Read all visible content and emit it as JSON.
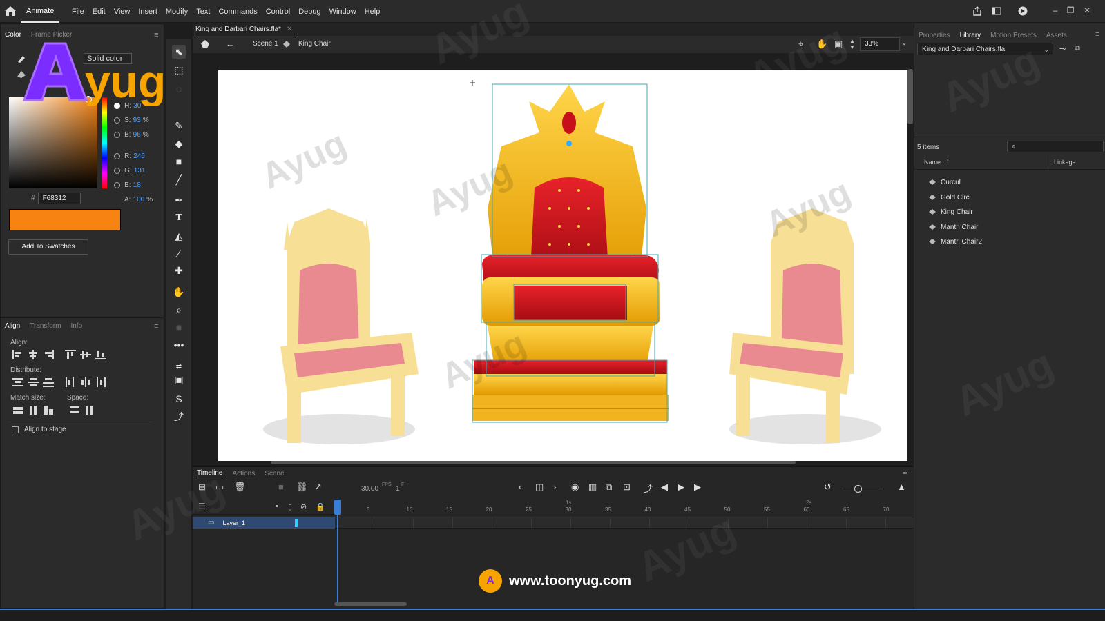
{
  "menubar": {
    "workspace": "Animate",
    "items": [
      "File",
      "Edit",
      "View",
      "Insert",
      "Modify",
      "Text",
      "Commands",
      "Control",
      "Debug",
      "Window",
      "Help"
    ]
  },
  "color_panel": {
    "tabs": [
      "Color",
      "Frame Picker"
    ],
    "mode": "Solid color",
    "hsb": {
      "h_label": "H:",
      "h": "30",
      "h_unit": "°",
      "s_label": "S:",
      "s": "93",
      "s_unit": "%",
      "b_label": "B:",
      "b": "96",
      "b_unit": "%"
    },
    "rgb": {
      "r_label": "R:",
      "r": "246",
      "g_label": "G:",
      "g": "131",
      "b_label": "B:",
      "b": "18"
    },
    "alpha_label": "A:",
    "alpha": "100",
    "alpha_unit": "%",
    "hex_prefix": "#",
    "hex": "F68312",
    "swatch_color": "#f68312",
    "add_swatches": "Add To Swatches"
  },
  "align_panel": {
    "tabs": [
      "Align",
      "Transform",
      "Info"
    ],
    "align_label": "Align:",
    "distribute_label": "Distribute:",
    "match_size_label": "Match size:",
    "space_label": "Space:",
    "align_to_stage": "Align to stage"
  },
  "document": {
    "tab": "King and Darbari Chairs.fla*",
    "scene": "Scene 1",
    "symbol": "King Chair",
    "zoom": "33%"
  },
  "timeline": {
    "tabs": [
      "Timeline",
      "Actions",
      "Scene"
    ],
    "fps": "30.00",
    "fps_unit": "FPS",
    "frame": "1",
    "frame_unit": "F",
    "seconds": [
      "1s",
      "2s"
    ],
    "frame_numbers": [
      "5",
      "10",
      "15",
      "20",
      "25",
      "30",
      "35",
      "40",
      "45",
      "50",
      "55",
      "60",
      "65",
      "70"
    ],
    "layer": "Layer_1"
  },
  "library": {
    "tabs": [
      "Properties",
      "Library",
      "Motion Presets",
      "Assets"
    ],
    "file": "King and Darbari Chairs.fla",
    "count": "5 items",
    "col_name": "Name",
    "col_linkage": "Linkage",
    "items": [
      "Curcul",
      "Gold Circ",
      "King Chair",
      "Mantri Chair",
      "Mantri Chair2"
    ]
  },
  "branding": {
    "logo": "Ayug",
    "url": "www.toonyug.com"
  },
  "colors": {
    "accent": "#4aa3ff",
    "gold": "#f4b400",
    "red": "#d4141c",
    "panel": "#2b2b2b"
  }
}
